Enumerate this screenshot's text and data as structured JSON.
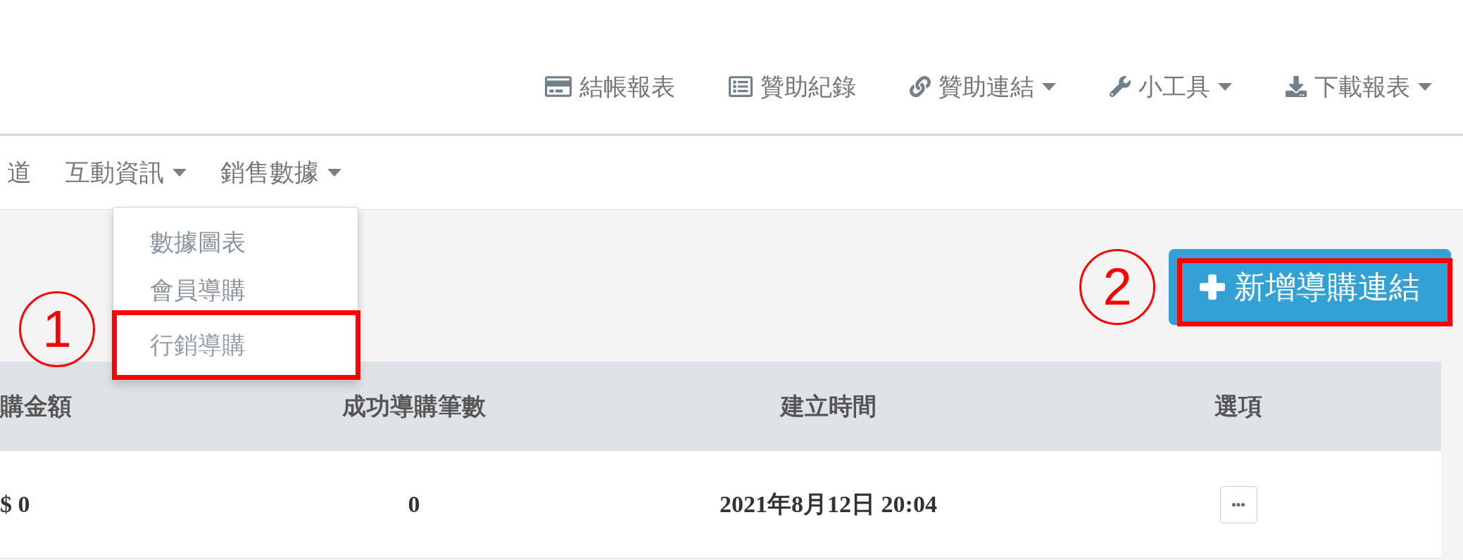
{
  "top_nav": [
    {
      "kind": "card",
      "label": "結帳報表",
      "dropdown": false
    },
    {
      "kind": "list",
      "label": "贊助紀錄",
      "dropdown": false
    },
    {
      "kind": "link",
      "label": "贊助連結",
      "dropdown": true
    },
    {
      "kind": "wrench",
      "label": "小工具",
      "dropdown": true
    },
    {
      "kind": "download",
      "label": "下載報表",
      "dropdown": true
    }
  ],
  "main_nav": [
    {
      "label": "道",
      "dropdown": false,
      "expanded": false
    },
    {
      "label": "互動資訊",
      "dropdown": true,
      "expanded": false
    },
    {
      "label": "銷售數據",
      "dropdown": true,
      "expanded": true
    }
  ],
  "dropdown_menu": {
    "items": [
      {
        "label": "數據圖表",
        "highlighted": false
      },
      {
        "label": "會員導購",
        "highlighted": false
      },
      {
        "label": "行銷導購",
        "highlighted": true
      }
    ]
  },
  "add_button": {
    "label": "新增導購連結",
    "highlighted": true
  },
  "annotations": [
    {
      "number": "1"
    },
    {
      "number": "2"
    }
  ],
  "table": {
    "columns": [
      "購金額",
      "成功導購筆數",
      "建立時間",
      "選項"
    ],
    "rows": [
      {
        "cells": [
          "$ 0",
          "0",
          "2021年8月12日 20:04"
        ]
      }
    ]
  }
}
